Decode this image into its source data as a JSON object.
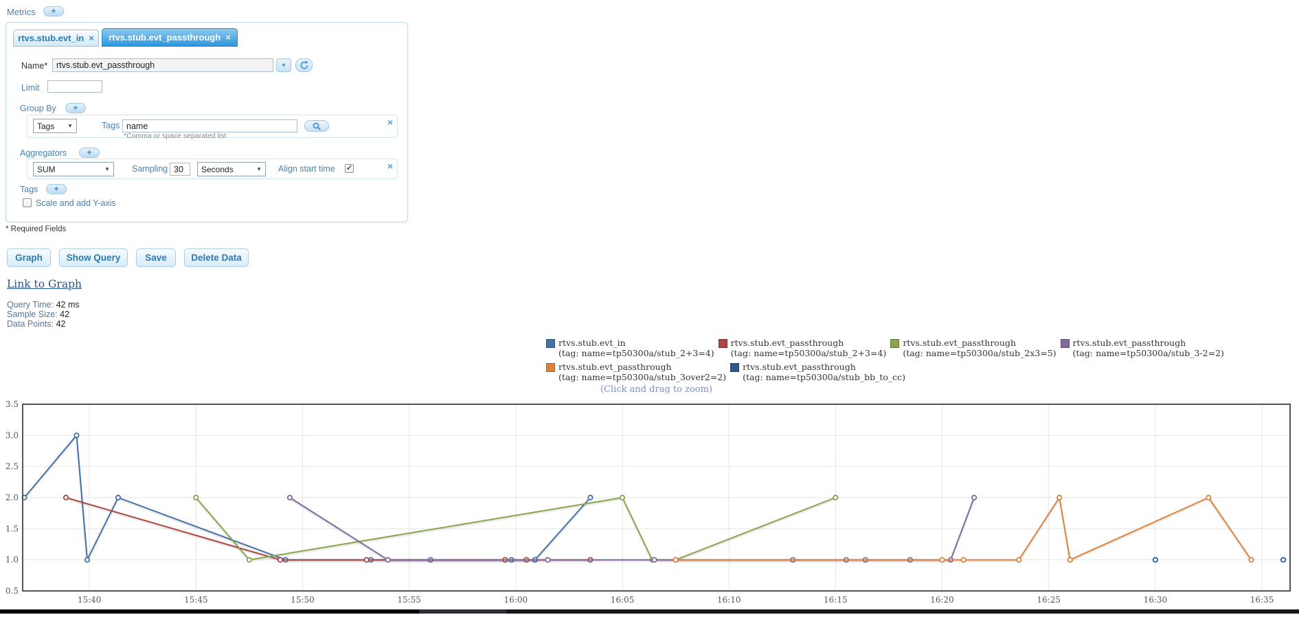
{
  "icons": {
    "add": "+",
    "close": "×",
    "caret": "▼",
    "check": "✓"
  },
  "metrics_section": {
    "label": "Metrics"
  },
  "tabs": [
    {
      "label": "rtvs.stub.evt_in",
      "active": false
    },
    {
      "label": "rtvs.stub.evt_passthrough",
      "active": true
    }
  ],
  "form": {
    "name_label": "Name*",
    "name_value": "rtvs.stub.evt_passthrough",
    "limit_label": "Limit",
    "limit_value": "",
    "group_by": {
      "label": "Group By",
      "type_select_value": "Tags",
      "tags_label": "Tags",
      "tags_value": "name",
      "hint": "*Comma or space separated list"
    },
    "aggregators": {
      "label": "Aggregators",
      "agg_select_value": "SUM",
      "sampling_label": "Sampling",
      "sampling_value": "30",
      "unit_select_value": "Seconds",
      "align_label": "Align start time",
      "align_checked": true
    },
    "tags": {
      "label": "Tags"
    },
    "scale_label": "Scale and add Y-axis",
    "scale_checked": false
  },
  "required_note": "* Required Fields",
  "actions": {
    "graph": "Graph",
    "show_query": "Show Query",
    "save": "Save",
    "delete_data": "Delete Data"
  },
  "link_to_graph": "Link to Graph",
  "stats": {
    "query_time_label": "Query Time:",
    "query_time_value": "42 ms",
    "sample_size_label": "Sample Size:",
    "sample_size_value": "42",
    "data_points_label": "Data Points:",
    "data_points_value": "42"
  },
  "zoom_hint": "(Click and drag to zoom)",
  "chart_data": {
    "type": "line",
    "x_axis": {
      "unit": "minutes after 15:00",
      "range_minutes": [
        36.87,
        96.32
      ],
      "ticks": [
        {
          "t": 40,
          "label": "15:40"
        },
        {
          "t": 45,
          "label": "15:45"
        },
        {
          "t": 50,
          "label": "15:50"
        },
        {
          "t": 55,
          "label": "15:55"
        },
        {
          "t": 60,
          "label": "16:00"
        },
        {
          "t": 65,
          "label": "16:05"
        },
        {
          "t": 70,
          "label": "16:10"
        },
        {
          "t": 75,
          "label": "16:15"
        },
        {
          "t": 80,
          "label": "16:20"
        },
        {
          "t": 85,
          "label": "16:25"
        },
        {
          "t": 90,
          "label": "16:30"
        },
        {
          "t": 95,
          "label": "16:35"
        }
      ]
    },
    "y_axis": {
      "range": [
        0.5,
        3.5
      ],
      "ticks": [
        {
          "v": 0.5,
          "label": "0.5"
        },
        {
          "v": 1.0,
          "label": "1.0"
        },
        {
          "v": 1.5,
          "label": "1.5"
        },
        {
          "v": 2.0,
          "label": "2.0"
        },
        {
          "v": 2.5,
          "label": "2.5"
        },
        {
          "v": 3.0,
          "label": "3.0"
        },
        {
          "v": 3.5,
          "label": "3.5"
        }
      ]
    },
    "grid": true,
    "legend_position": "top-right",
    "series": [
      {
        "name": "rtvs.stub.evt_in",
        "tag": "name=tp50300a/stub_2+3=4",
        "color": "#4572A7",
        "points": [
          [
            36.95,
            2
          ],
          [
            39.4,
            3
          ],
          [
            39.9,
            1
          ],
          [
            41.35,
            2
          ],
          [
            49.2,
            1
          ],
          [
            53.2,
            1
          ],
          [
            56,
            1
          ],
          [
            59.8,
            1
          ],
          [
            60.9,
            1
          ],
          [
            63.5,
            2
          ]
        ]
      },
      {
        "name": "rtvs.stub.evt_passthrough",
        "tag": "name=tp50300a/stub_2+3=4",
        "color": "#AA4643",
        "points": [
          [
            38.9,
            2
          ],
          [
            48.95,
            1
          ],
          [
            53,
            1
          ],
          [
            59.5,
            1
          ],
          [
            60.5,
            1
          ],
          [
            63.5,
            1
          ]
        ]
      },
      {
        "name": "rtvs.stub.evt_passthrough",
        "tag": "name=tp50300a/stub_2x3=5",
        "color": "#89A54E",
        "points": [
          [
            45,
            2
          ],
          [
            47.5,
            1
          ],
          [
            65,
            2
          ],
          [
            66.4,
            1
          ],
          [
            67.5,
            1
          ],
          [
            75,
            2
          ]
        ]
      },
      {
        "name": "rtvs.stub.evt_passthrough",
        "tag": "name=tp50300a/stub_3-2=2",
        "color": "#80699B",
        "points": [
          [
            49.4,
            2
          ],
          [
            54,
            1
          ],
          [
            61.5,
            1
          ],
          [
            66.5,
            1
          ],
          [
            73,
            1
          ],
          [
            75.5,
            1
          ],
          [
            76.4,
            1
          ],
          [
            78.5,
            1
          ],
          [
            80.4,
            1
          ],
          [
            81.5,
            2
          ]
        ]
      },
      {
        "name": "rtvs.stub.evt_passthrough",
        "tag": "name=tp50300a/stub_3over2=2",
        "color": "#DB843D",
        "points": [
          [
            67.5,
            1
          ],
          [
            80,
            1
          ],
          [
            81,
            1
          ],
          [
            83.6,
            1
          ],
          [
            85.5,
            2
          ],
          [
            86,
            1
          ],
          [
            92.5,
            2
          ],
          [
            94.5,
            1
          ]
        ]
      },
      {
        "name": "rtvs.stub.evt_passthrough",
        "tag": "name=tp50300a/stub_bb_to_cc",
        "color": "#30588C",
        "points": [
          [
            90,
            1
          ],
          [
            96,
            1
          ]
        ]
      }
    ]
  }
}
